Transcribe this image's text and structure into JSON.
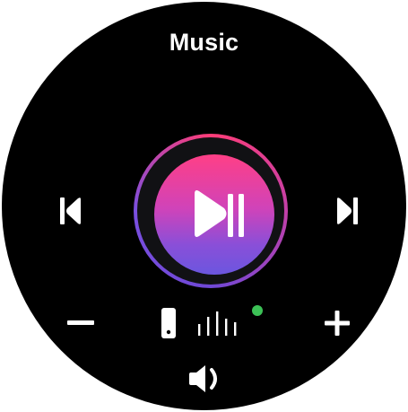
{
  "app": {
    "title": "Music"
  },
  "controls": {
    "previous": "previous-track-icon",
    "play_pause": "play-pause-icon",
    "next": "next-track-icon",
    "volume_down": "minus-icon",
    "volume_up": "plus-icon",
    "output_device": "phone-icon",
    "volume_level": "volume-bars-icon",
    "speaker": "speaker-icon"
  },
  "status": {
    "connected": true,
    "connected_color": "#3cc156"
  },
  "colors": {
    "background": "#000000",
    "foreground": "#ffffff",
    "accent_top": "#ff3f86",
    "accent_bottom": "#6b56df"
  }
}
